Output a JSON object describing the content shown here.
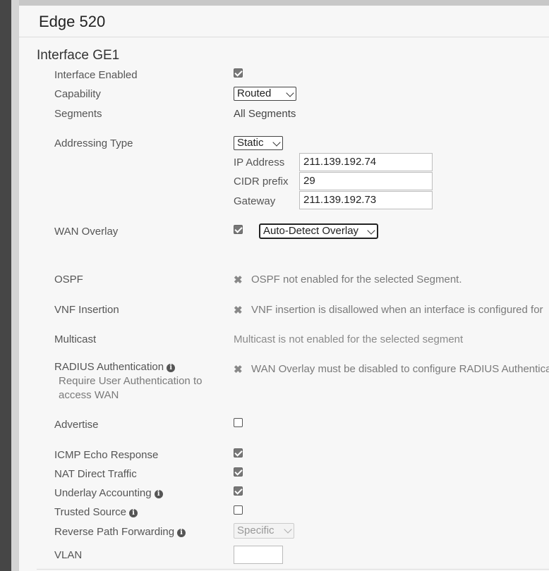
{
  "panel": {
    "title": "Edge 520"
  },
  "interface": {
    "section_title": "Interface GE1",
    "enabled": {
      "label": "Interface Enabled",
      "checked": true
    },
    "capability": {
      "label": "Capability",
      "value": "Routed"
    },
    "segments": {
      "label": "Segments",
      "value": "All Segments"
    },
    "addressing": {
      "label": "Addressing Type",
      "value": "Static",
      "ip_label": "IP Address",
      "ip_value": "211.139.192.74",
      "cidr_label": "CIDR prefix",
      "cidr_value": "29",
      "gateway_label": "Gateway",
      "gateway_value": "211.139.192.73"
    },
    "wan_overlay": {
      "label": "WAN Overlay",
      "checked": true,
      "value": "Auto-Detect Overlay"
    },
    "ospf": {
      "label": "OSPF",
      "message": "OSPF not enabled for the selected Segment."
    },
    "vnf": {
      "label": "VNF Insertion",
      "message": "VNF insertion is disallowed when an interface is configured for"
    },
    "multicast": {
      "label": "Multicast",
      "message": "Multicast is not enabled for the selected segment"
    },
    "radius": {
      "label": "RADIUS Authentication",
      "sublabel": "Require User Authentication to access WAN",
      "message": "WAN Overlay must be disabled to configure RADIUS Authentica"
    },
    "advertise": {
      "label": "Advertise",
      "checked": false
    },
    "icmp": {
      "label": "ICMP Echo Response",
      "checked": true
    },
    "nat": {
      "label": "NAT Direct Traffic",
      "checked": true
    },
    "underlay": {
      "label": "Underlay Accounting",
      "checked": true
    },
    "trusted": {
      "label": "Trusted Source",
      "checked": false
    },
    "rpf": {
      "label": "Reverse Path Forwarding",
      "value": "Specific"
    },
    "vlan": {
      "label": "VLAN",
      "value": ""
    }
  },
  "icons": {
    "info": "info-icon",
    "disabled": "x-icon"
  }
}
